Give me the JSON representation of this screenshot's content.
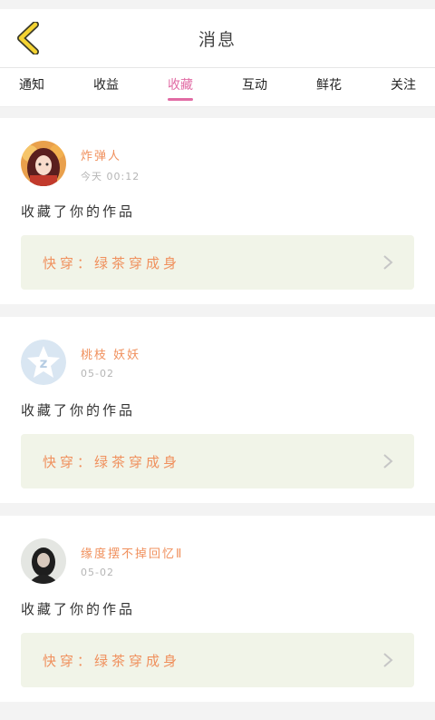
{
  "header": {
    "title": "消息"
  },
  "tabs": [
    {
      "label": "通知",
      "active": false
    },
    {
      "label": "收益",
      "active": false
    },
    {
      "label": "收藏",
      "active": true
    },
    {
      "label": "互动",
      "active": false
    },
    {
      "label": "鲜花",
      "active": false
    },
    {
      "label": "关注",
      "active": false
    }
  ],
  "messages": [
    {
      "username": "炸弹人",
      "time": "今天 00:12",
      "action": "收藏了你的作品",
      "work_title": "快穿：绿茶穿成身",
      "avatar_icon": "anime-girl-avatar"
    },
    {
      "username": "桃枝 妖妖",
      "time": "05-02",
      "action": "收藏了你的作品",
      "work_title": "快穿：绿茶穿成身",
      "avatar_icon": "default-z-avatar"
    },
    {
      "username": "缘度摆不掉回忆Ⅱ",
      "time": "05-02",
      "action": "收藏了你的作品",
      "work_title": "快穿：绿茶穿成身",
      "avatar_icon": "dark-hair-girl-avatar"
    }
  ],
  "colors": {
    "accent_pink": "#e16ba4",
    "username_orange": "#f0905d",
    "back_arrow_yellow": "#f4d332",
    "work_box_bg": "#f1f4e8"
  }
}
